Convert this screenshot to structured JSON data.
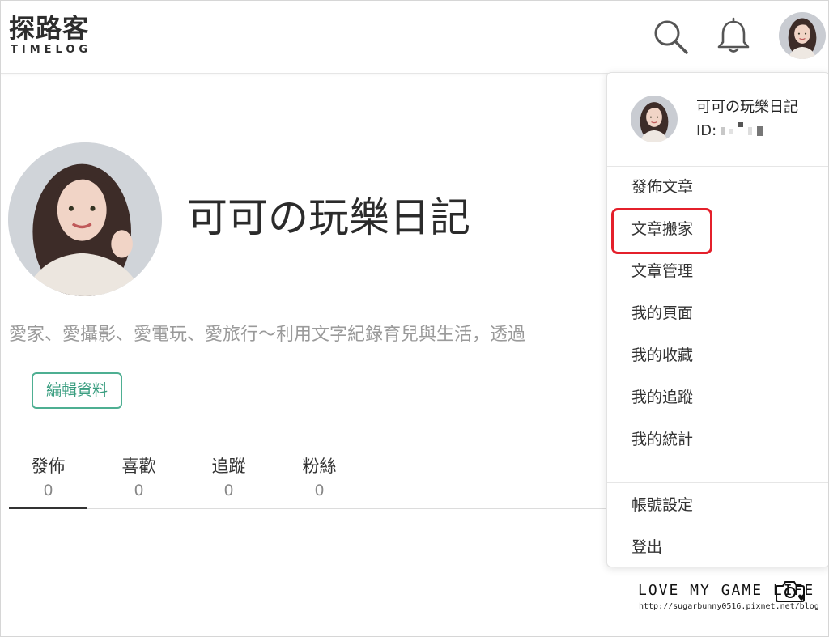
{
  "header": {
    "logo_cn": "探路客",
    "logo_en": "TIMELOG",
    "icons": [
      "search-icon",
      "bell-icon"
    ]
  },
  "profile": {
    "name": "可可の玩樂日記",
    "bio": "愛家、愛攝影、愛電玩、愛旅行～利用文字紀錄育兒與生活，透過",
    "edit_label": "編輯資料",
    "stats": [
      {
        "label": "發佈",
        "value": "0"
      },
      {
        "label": "喜歡",
        "value": "0"
      },
      {
        "label": "追蹤",
        "value": "0"
      },
      {
        "label": "粉絲",
        "value": "0"
      }
    ]
  },
  "dropdown": {
    "name": "可可の玩樂日記",
    "id_label": "ID:",
    "items": [
      "發佈文章",
      "文章搬家",
      "文章管理",
      "我的頁面",
      "我的收藏",
      "我的追蹤",
      "我的統計"
    ],
    "footer_items": [
      "帳號設定",
      "登出"
    ],
    "highlighted_item": "文章搬家"
  },
  "watermark": {
    "title": "LOVE MY GAME LIFE",
    "url": "http://sugarbunny0516.pixnet.net/blog"
  },
  "colors": {
    "accent": "#4eaf92",
    "highlight": "#e4202b",
    "text": "#333333",
    "muted": "#9a9a9a"
  }
}
